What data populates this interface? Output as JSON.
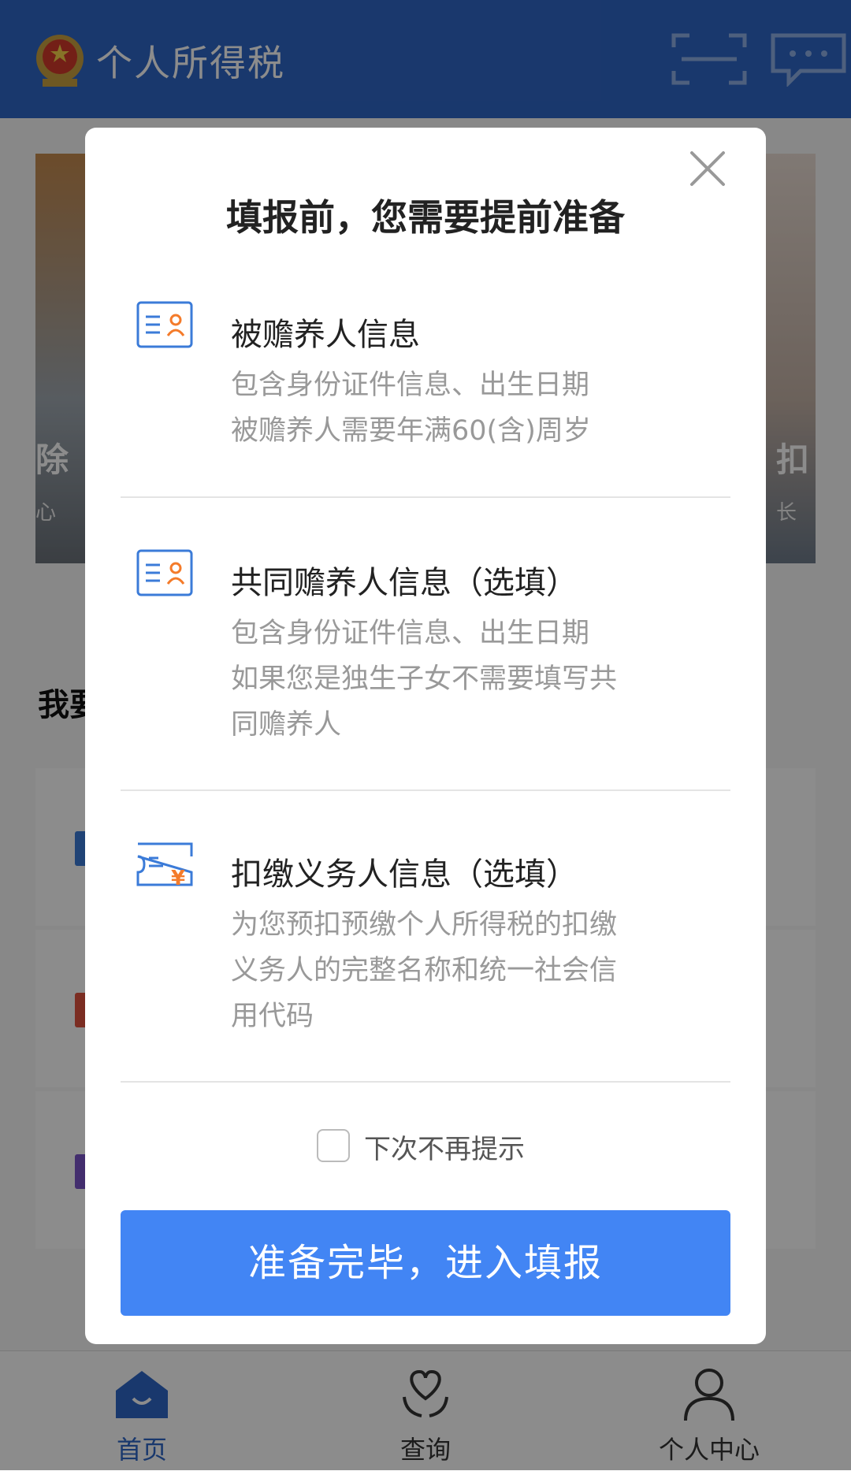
{
  "header": {
    "app_title": "个人所得税"
  },
  "background": {
    "banner_left_text": "除",
    "banner_left_sub": "心",
    "banner_right_text": "扣",
    "banner_right_sub": "长",
    "section_title": "我要"
  },
  "modal": {
    "title": "填报前，您需要提前准备",
    "items": [
      {
        "title": "被赡养人信息",
        "desc": [
          "包含身份证件信息、出生日期",
          "被赡养人需要年满60(含)周岁"
        ],
        "icon": "id-card-icon"
      },
      {
        "title": "共同赡养人信息（选填）",
        "desc": [
          "包含身份证件信息、出生日期",
          "如果您是独生子女不需要填写共",
          "同赡养人"
        ],
        "icon": "id-card-icon"
      },
      {
        "title": "扣缴义务人信息（选填）",
        "desc": [
          "为您预扣预缴个人所得税的扣缴",
          "义务人的完整名称和统一社会信",
          "用代码"
        ],
        "icon": "ticket-yuan-icon"
      }
    ],
    "checkbox_label": "下次不再提示",
    "primary_button": "准备完毕，进入填报"
  },
  "tabbar": {
    "tabs": [
      {
        "label": "首页",
        "active": true
      },
      {
        "label": "查询",
        "active": false
      },
      {
        "label": "个人中心",
        "active": false
      }
    ]
  },
  "colors": {
    "brand": "#2f66c6",
    "primary_button": "#4285f4",
    "accent_orange": "#f47b2a"
  }
}
